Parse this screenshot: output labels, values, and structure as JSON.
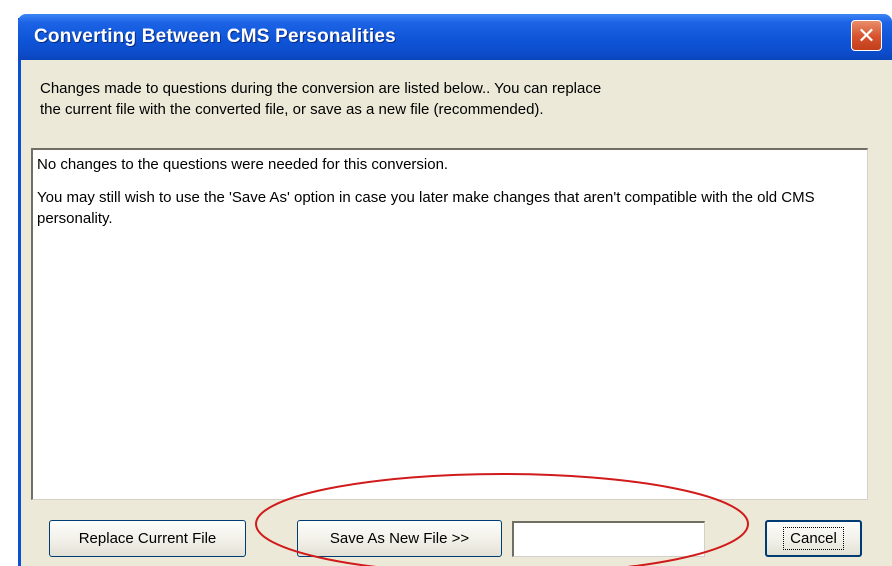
{
  "window": {
    "title": "Converting Between CMS Personalities",
    "close_glyph": "✕"
  },
  "intro": {
    "line1": "Changes made to questions during the conversion are listed below..  You can replace",
    "line2": "the current file with the converted file, or save as a new file (recommended)."
  },
  "changes_box": {
    "paragraph1": "No changes to the questions were needed for this conversion.",
    "paragraph2": "You may still wish to use the 'Save As' option in case you later make changes that aren't compatible with the old CMS personality."
  },
  "buttons": {
    "replace_label": "Replace Current File",
    "save_as_label": "Save As New File >>",
    "cancel_label": "Cancel"
  },
  "new_file_input": {
    "value": "",
    "placeholder": ""
  },
  "colors": {
    "titlebar": "#0c4ccb",
    "dialog_bg": "#ece9d8",
    "highlight_ellipse": "#d11a1a"
  }
}
